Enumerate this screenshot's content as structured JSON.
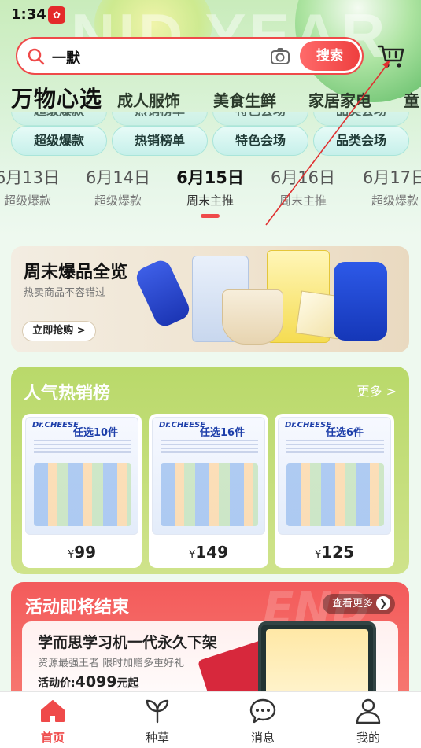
{
  "status_bar": {
    "time": "1:34",
    "app_badge": "HUA"
  },
  "header": {
    "bg_text": "NID YEAR"
  },
  "search": {
    "value": "一默",
    "button": "搜索"
  },
  "category_nav": {
    "logo": "万物心选",
    "items": [
      "成人服饰",
      "美食生鲜",
      "家居家电",
      "童"
    ]
  },
  "pills": [
    "超级爆款",
    "热销榜单",
    "特色会场",
    "品类会场"
  ],
  "date_tabs": [
    {
      "date": "6月13日",
      "sub": "超级爆款",
      "active": false
    },
    {
      "date": "6月14日",
      "sub": "超级爆款",
      "active": false
    },
    {
      "date": "6月15日",
      "sub": "周末主推",
      "active": true
    },
    {
      "date": "6月16日",
      "sub": "周末主推",
      "active": false
    },
    {
      "date": "6月17日",
      "sub": "超级爆款",
      "active": false
    }
  ],
  "promo": {
    "title": "周末爆品全览",
    "subtitle": "热卖商品不容错过",
    "button": "立即抢购 >"
  },
  "hot_sales": {
    "title": "人气热销榜",
    "more": "更多 >",
    "products": [
      {
        "brand": "Dr.CHEESE",
        "tag": "任选10件",
        "currency": "¥",
        "price": "99"
      },
      {
        "brand": "Dr.CHEESE",
        "tag": "任选16件",
        "currency": "¥",
        "price": "149"
      },
      {
        "brand": "Dr.CHEESE",
        "tag": "任选6件",
        "currency": "¥",
        "price": "125"
      }
    ]
  },
  "ending_soon": {
    "title": "活动即将结束",
    "more": "查看更多",
    "bg_text": "END",
    "headline": "学而思学习机一代永久下架",
    "subline": "资源最强王者 限时加赠多重好礼",
    "price_label": "活动价:",
    "price_value": "4099",
    "price_suffix": "元起"
  },
  "tabbar": [
    {
      "label": "首页",
      "icon": "home-icon",
      "active": true
    },
    {
      "label": "种草",
      "icon": "sprout-icon",
      "active": false
    },
    {
      "label": "消息",
      "icon": "chat-icon",
      "active": false
    },
    {
      "label": "我的",
      "icon": "user-icon",
      "active": false
    }
  ],
  "colors": {
    "accent": "#ef4a4a",
    "hot_bg": "#b9d96a",
    "pill_bg": "#c6f0ea"
  }
}
